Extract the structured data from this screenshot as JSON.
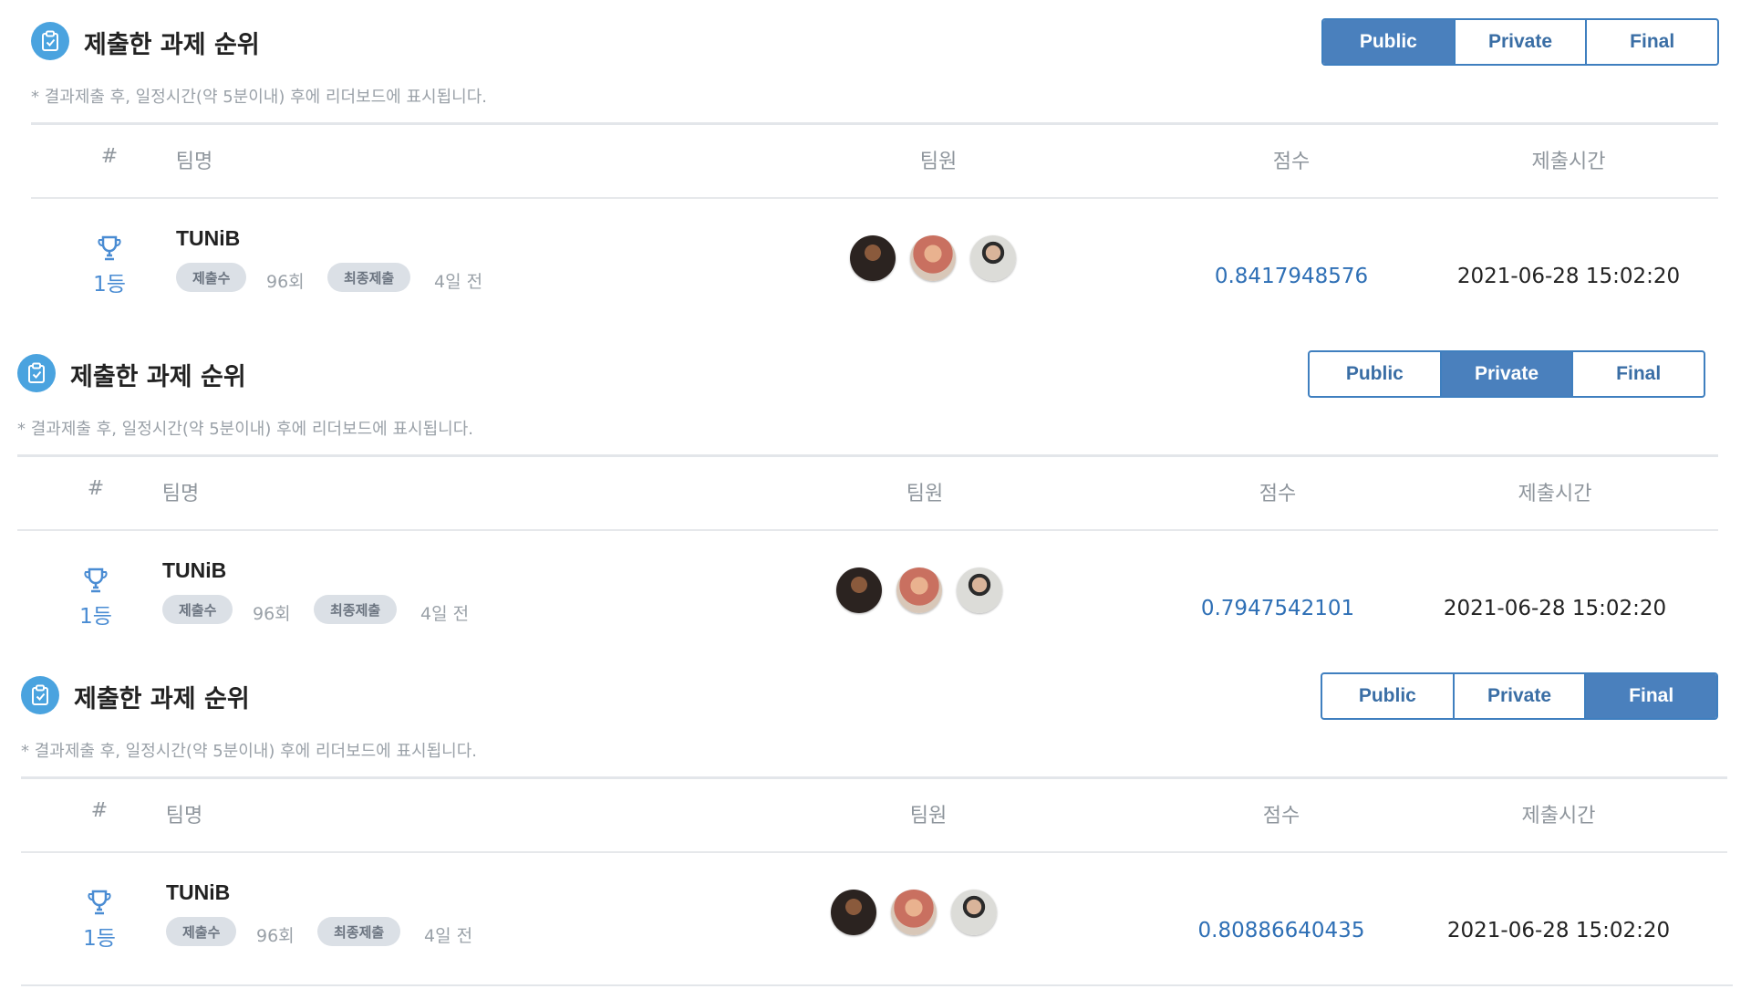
{
  "panels": [
    {
      "title": "제출한 과제 순위",
      "note": "* 결과제출 후, 일정시간(약 5분이내) 후에 리더보드에 표시됩니다.",
      "tabs": [
        "Public",
        "Private",
        "Final"
      ],
      "active_tab": "Public",
      "columns": [
        "#",
        "팀명",
        "팀원",
        "점수",
        "제출시간"
      ],
      "row": {
        "rank": "1등",
        "team": "TUNiB",
        "submit_count_label": "제출수",
        "submit_count": "96회",
        "last_submit_label": "최종제출",
        "last_submit": "4일 전",
        "score": "0.8417948576",
        "time": "2021-06-28 15:02:20"
      }
    },
    {
      "title": "제출한 과제 순위",
      "note": "* 결과제출 후, 일정시간(약 5분이내) 후에 리더보드에 표시됩니다.",
      "tabs": [
        "Public",
        "Private",
        "Final"
      ],
      "active_tab": "Private",
      "columns": [
        "#",
        "팀명",
        "팀원",
        "점수",
        "제출시간"
      ],
      "row": {
        "rank": "1등",
        "team": "TUNiB",
        "submit_count_label": "제출수",
        "submit_count": "96회",
        "last_submit_label": "최종제출",
        "last_submit": "4일 전",
        "score": "0.7947542101",
        "time": "2021-06-28 15:02:20"
      }
    },
    {
      "title": "제출한 과제 순위",
      "note": "* 결과제출 후, 일정시간(약 5분이내) 후에 리더보드에 표시됩니다.",
      "tabs": [
        "Public",
        "Private",
        "Final"
      ],
      "active_tab": "Final",
      "columns": [
        "#",
        "팀명",
        "팀원",
        "점수",
        "제출시간"
      ],
      "row": {
        "rank": "1등",
        "team": "TUNiB",
        "submit_count_label": "제출수",
        "submit_count": "96회",
        "last_submit_label": "최종제출",
        "last_submit": "4일 전",
        "score": "0.80886640435",
        "time": "2021-06-28 15:02:20"
      }
    }
  ],
  "colors": {
    "accent": "#4a80bd",
    "score": "#2e6fb5",
    "rank": "#4a8cd3",
    "icon": "#4aa3df"
  },
  "icons": {
    "title": "clipboard-check-icon",
    "rank": "trophy-icon"
  }
}
